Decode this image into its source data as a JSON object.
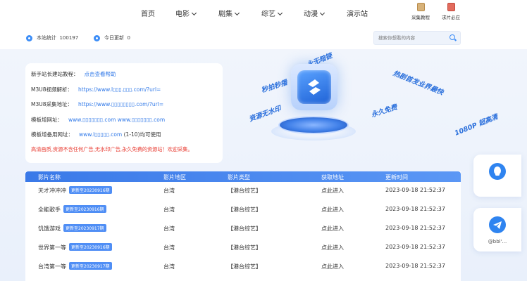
{
  "nav": {
    "items": [
      {
        "label": "首页",
        "dropdown": false
      },
      {
        "label": "电影",
        "dropdown": true
      },
      {
        "label": "剧集",
        "dropdown": true
      },
      {
        "label": "综艺",
        "dropdown": true
      },
      {
        "label": "动漫",
        "dropdown": true
      },
      {
        "label": "演示站",
        "dropdown": false
      }
    ],
    "tools": [
      {
        "label": "采集教程",
        "icon": "tutorial-icon"
      },
      {
        "label": "求片必应",
        "icon": "request-icon"
      }
    ]
  },
  "stats": {
    "total_label": "本站统计",
    "total_value": "100197",
    "today_label": "今日更新",
    "today_value": "0"
  },
  "search": {
    "placeholder": "搜索你想看的内容"
  },
  "info": {
    "tutorial_label": "新手站长建站教程：",
    "tutorial_link": "点击查看帮助",
    "m3u8_parse_label": "M3U8视频解析：",
    "m3u8_parse_url": "https://www.l▯▯▯.▯▯▯.com/?url=",
    "m3u8_collect_label": "M3U8采集地址：",
    "m3u8_collect_url": "https://www.▯▯▯▯▯▯▯▯.com/?url=",
    "template_label": "模板增网址：",
    "template_url": "www.▯▯▯▯▯▯▯.com    www.▯▯▯▯▯▯▯.com",
    "template_backup_label": "模板增备用网址：",
    "template_backup_url": "www.l▯▯▯▯▯.com",
    "template_backup_note": "(1-10)均可使用",
    "notice": "高清画质,资源不含任何广告,无水印广告,永久免费的资源站！欢迎采集。"
  },
  "promo": {
    "tags": [
      "永无暗链",
      "秒拍秒播",
      "热剧首发业界最快",
      "资源无水印",
      "永久免费",
      "1080P 超高清"
    ]
  },
  "table": {
    "headers": [
      "影片名称",
      "影片地区",
      "影片类型",
      "获取地址",
      "更新时间"
    ],
    "rows": [
      {
        "name": "天才冲冲冲",
        "badge": "更新至20230916期",
        "region": "台湾",
        "type": "【港台综艺】",
        "action": "点此进入",
        "time": "2023-09-18 21:52:37"
      },
      {
        "name": "全能歌手",
        "badge": "更新至20230916期",
        "region": "台湾",
        "type": "【港台综艺】",
        "action": "点此进入",
        "time": "2023-09-18 21:52:37"
      },
      {
        "name": "饥饿游戏",
        "badge": "更新至20230917期",
        "region": "台湾",
        "type": "【港台综艺】",
        "action": "点此进入",
        "time": "2023-09-18 21:52:37"
      },
      {
        "name": "世界第一等",
        "badge": "更新至20230916期",
        "region": "台湾",
        "type": "【港台综艺】",
        "action": "点此进入",
        "time": "2023-09-18 21:52:37"
      },
      {
        "name": "台湾第一等",
        "badge": "更新至20230917期",
        "region": "台湾",
        "type": "【港台综艺】",
        "action": "点此进入",
        "time": "2023-09-18 21:52:37"
      }
    ]
  },
  "float": {
    "qq_icon": "qq-icon",
    "telegram_icon": "telegram-icon",
    "telegram_label": "@bbl'..."
  },
  "colors": {
    "accent": "#3c8df7",
    "header_bar": "#3a79e8",
    "notice": "#e8392f",
    "link": "#2f78e8"
  }
}
